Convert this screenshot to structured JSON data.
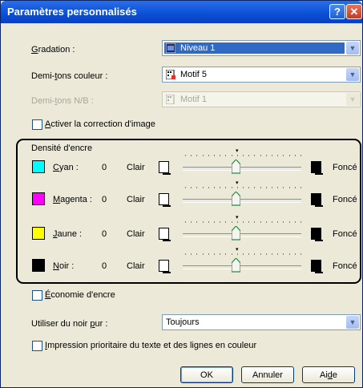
{
  "window": {
    "title": "Paramètres personnalisés",
    "help_label": "?",
    "close_label": "✕"
  },
  "gradation": {
    "label_pre": "",
    "label_accel": "G",
    "label_post": "radation :",
    "value": "Niveau 1"
  },
  "demi_couleur": {
    "label_pre": "Demi-",
    "label_accel": "t",
    "label_post": "ons couleur :",
    "value": "Motif 5"
  },
  "demi_nb": {
    "label_pre": "Demi-",
    "label_accel": "t",
    "label_post": "ons N/B :",
    "value": "Motif 1"
  },
  "correction": {
    "label_pre": "",
    "label_accel": "A",
    "label_post": "ctiver la correction d'image"
  },
  "density": {
    "title": "Densité d'encre",
    "clair": "Clair",
    "fonce": "Foncé",
    "inks": [
      {
        "pre": "",
        "accel": "C",
        "post": "yan :",
        "value": "0",
        "color": "#00ffff",
        "level": 0
      },
      {
        "pre": "",
        "accel": "M",
        "post": "agenta :",
        "value": "0",
        "color": "#ff00ff",
        "level": 0
      },
      {
        "pre": "",
        "accel": "J",
        "post": "aune :",
        "value": "0",
        "color": "#ffff00",
        "level": 0
      },
      {
        "pre": "",
        "accel": "N",
        "post": "oir :",
        "value": "0",
        "color": "#000000",
        "level": 0
      }
    ]
  },
  "economie": {
    "label_pre": "",
    "label_accel": "É",
    "label_post": "conomie d'encre"
  },
  "noir_pur": {
    "label_pre": "Utiliser du noir ",
    "label_accel": "p",
    "label_post": "ur :",
    "value": "Toujours"
  },
  "prioritaire": {
    "label_pre": "",
    "label_accel": "I",
    "label_post": "mpression prioritaire du texte et des lignes en couleur"
  },
  "buttons": {
    "ok": "OK",
    "cancel": "Annuler",
    "help_pre": "Ai",
    "help_accel": "d",
    "help_post": "e"
  },
  "colors": {
    "title_blue": "#0a4fd6",
    "highlight": "#316ac5",
    "dialog_bg": "#ece9d8"
  },
  "icons": {
    "gradation": "gradation-icon",
    "halftone": "halftone-pattern-icon"
  }
}
